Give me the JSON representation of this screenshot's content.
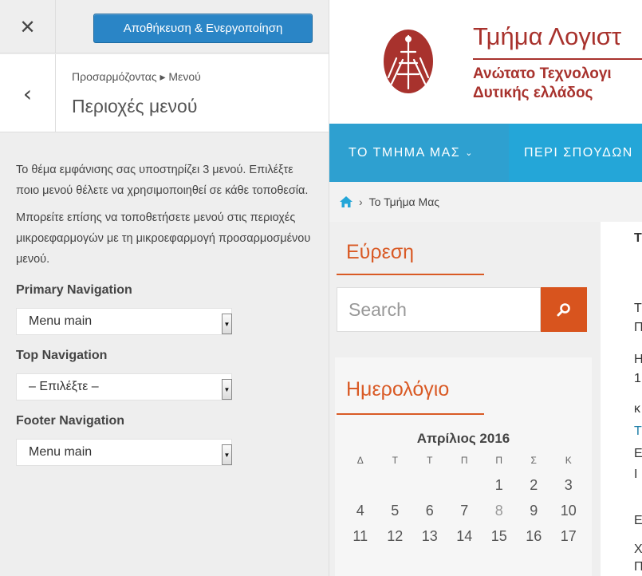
{
  "customizer": {
    "close_glyph": "✕",
    "save_button": "Αποθήκευση & Ενεργοποίηση",
    "back_glyph": "‹",
    "breadcrumb": "Προσαρμόζοντας ▸ Μενού",
    "section_title": "Περιοχές μενού",
    "description_1": "Το θέμα εμφάνισης σας υποστηρίζει 3 μενού. Επιλέξτε ποιο μενού θέλετε να χρησιμοποιηθεί σε κάθε τοποθεσία.",
    "description_2": "Μπορείτε επίσης να τοποθετήσετε μενού στις περιοχές μικροεφαρμογών με τη μικροεφαρμογή προσαρμοσμένου μενού.",
    "locations": [
      {
        "label": "Primary Navigation",
        "selected": "Menu main"
      },
      {
        "label": "Top Navigation",
        "selected": "– Επιλέξτε –"
      },
      {
        "label": "Footer Navigation",
        "selected": "Menu main"
      }
    ]
  },
  "site": {
    "title": "Τμήμα Λογιστ",
    "subtitle_1": "Ανώτατο Τεχνολογι",
    "subtitle_2": "Δυτικής ελλάδος",
    "nav": [
      {
        "label": "ΤΟ ΤΜΗΜΑ ΜΑΣ",
        "has_dropdown": true
      },
      {
        "label": "ΠΕΡΙ ΣΠΟΥΔΩΝ",
        "has_dropdown": false
      }
    ],
    "breadcrumb": {
      "separator": "›",
      "current": "Το Τμήμα Μας"
    },
    "search_widget": {
      "title": "Εύρεση",
      "placeholder": "Search"
    },
    "calendar_widget": {
      "title": "Ημερολόγιο",
      "caption": "Απρίλιος 2016",
      "weekdays": [
        "Δ",
        "Τ",
        "Τ",
        "Π",
        "Π",
        "Σ",
        "Κ"
      ],
      "weeks": [
        [
          "",
          "",
          "",
          "",
          "1",
          "2",
          "3"
        ],
        [
          "4",
          "5",
          "6",
          "7",
          "8",
          "9",
          "10"
        ],
        [
          "11",
          "12",
          "13",
          "14",
          "15",
          "16",
          "17"
        ]
      ]
    },
    "content_fragments": [
      "Τ",
      "Τ",
      "Π",
      "Η",
      "1",
      "κ",
      "Τ",
      "Ε",
      "Ι",
      "Ε",
      "Χ",
      "Π"
    ]
  },
  "colors": {
    "accent_blue": "#2a85c6",
    "nav_blue": "#24a6d8",
    "brand_red": "#a8322d",
    "widget_orange": "#d95a25"
  }
}
